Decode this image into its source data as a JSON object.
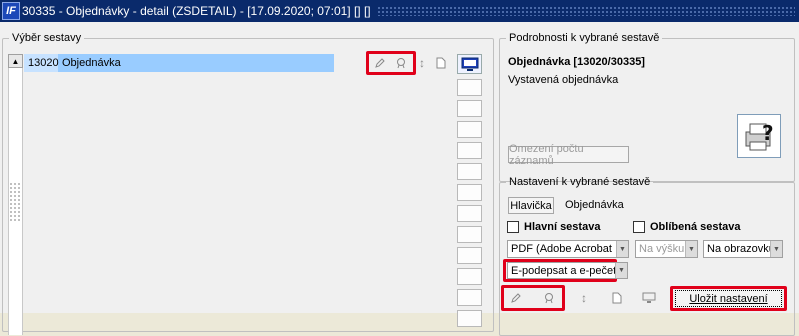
{
  "window": {
    "title": "30335 - Objednávky - detail (ZSDETAIL) - [17.09.2020; 07:01] [] []"
  },
  "left_panel": {
    "legend": "Výběr sestavy",
    "rows": [
      {
        "code": "13020",
        "name": "Objednávka"
      }
    ]
  },
  "detail_panel": {
    "legend": "Podrobnosti k vybrané sestavě",
    "title": "Objednávka [13020/30335]",
    "description": "Vystavená objednávka",
    "limit_button": "Omezení počtu záznamů"
  },
  "settings_panel": {
    "legend": "Nastavení k vybrané sestavě",
    "header_button": "Hlavička",
    "header_value": "Objednávka",
    "main_report_label": "Hlavní sestava",
    "favorite_label": "Oblíbená sestava",
    "format_select": "PDF (Adobe Acrobat ...",
    "orientation_select": "Na výšku",
    "output_select": "Na obrazovku",
    "sign_select": "E-podepsat a e-pečetit",
    "save_button": "Uložit nastavení"
  },
  "colors": {
    "titlebar": "#0a2a6b",
    "selection": "#99ccff",
    "highlight_box": "#e0001a"
  }
}
